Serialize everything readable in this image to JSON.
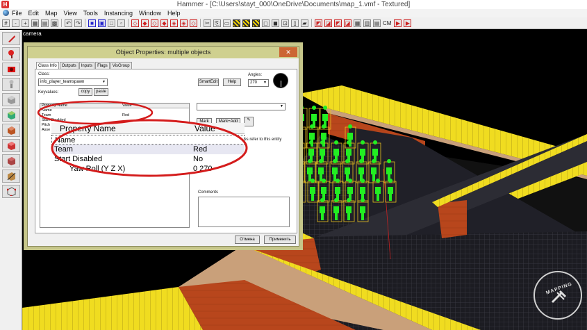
{
  "window": {
    "title": "Hammer - [C:\\Users\\stayt_000\\OneDrive\\Documents\\map_1.vmf - Textured]"
  },
  "menu": [
    "File",
    "Edit",
    "Map",
    "View",
    "Tools",
    "Instancing",
    "Window",
    "Help"
  ],
  "toolbar": {
    "cm_label": "CM"
  },
  "viewport": {
    "label": "camera"
  },
  "dialog": {
    "title": "Object Properties: multiple objects",
    "tabs": [
      "Class Info",
      "Outputs",
      "Inputs",
      "Flags",
      "VisGroup"
    ],
    "class_label": "Class:",
    "class_value": "info_player_teamspawn",
    "keyvalues_label": "Keyvalues:",
    "copy_label": "copy",
    "paste_label": "paste",
    "smartedit_label": "SmartEdit",
    "help_label": "Help",
    "angles_label": "Angles:",
    "angles_value": "270",
    "mark_label": "Mark",
    "mark_add_label": "Mark+Add",
    "entities_note": "ntities refer to this entity",
    "comments_label": "Comments",
    "cancel_label": "Отмена",
    "apply_label": "Применить",
    "small_table": {
      "headers": [
        "Property Name",
        "Value"
      ],
      "rows": [
        {
          "name": "Name",
          "value": ""
        },
        {
          "name": "Team",
          "value": "Red"
        },
        {
          "name": "Start Disabled",
          "value": ""
        },
        {
          "name": "Pitch",
          "value": ""
        },
        {
          "name": "Asse",
          "value": ""
        }
      ]
    }
  },
  "zoom_table": {
    "headers": [
      "Property Name",
      "Value"
    ],
    "rows": [
      {
        "name": "Name",
        "value": ""
      },
      {
        "name": "Team",
        "value": "Red"
      },
      {
        "name": "Start Disabled",
        "value": "No"
      },
      {
        "name": "Yaw Roll (Y Z X)",
        "value": "0 270"
      }
    ]
  },
  "watermark": {
    "text": "MAPPING"
  },
  "colors": {
    "highlight_ellipse": "#d41c1c",
    "dialog_frame": "#c6c68a",
    "spawn_green": "#22ee22"
  }
}
